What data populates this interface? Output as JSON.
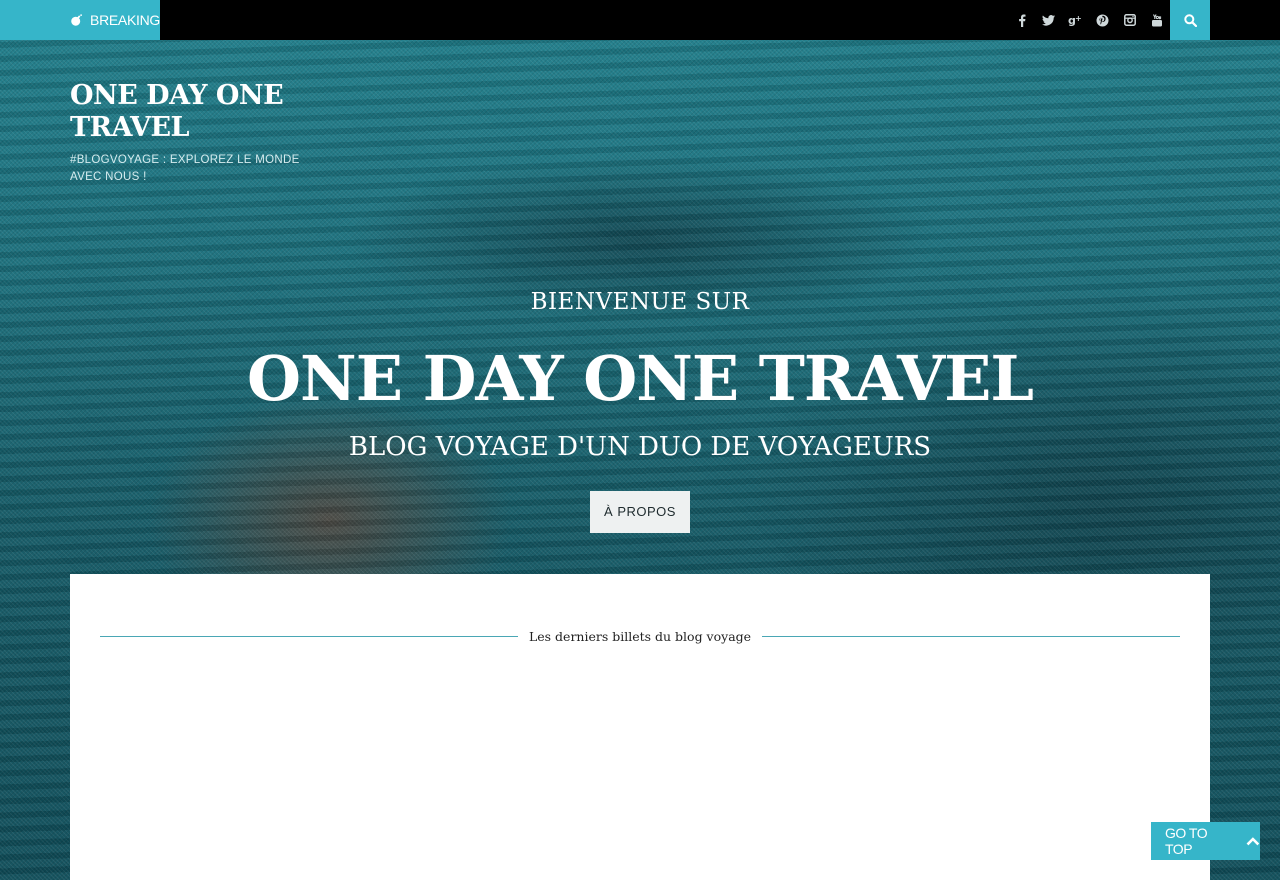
{
  "topbar": {
    "breaking_label": "BREAKING",
    "social": [
      {
        "icon": "facebook-icon",
        "glyph": "f"
      },
      {
        "icon": "twitter-icon",
        "glyph": "t"
      },
      {
        "icon": "google-plus-icon",
        "glyph": "g+"
      },
      {
        "icon": "pinterest-icon",
        "glyph": "p"
      },
      {
        "icon": "instagram-icon",
        "glyph": "◙"
      },
      {
        "icon": "youtube-icon",
        "glyph": "▶"
      }
    ],
    "search_icon": "search-icon"
  },
  "header": {
    "site_title": "ONE DAY ONE TRAVEL",
    "site_description": "#BLOGVOYAGE : EXPLOREZ LE MONDE AVEC NOUS !"
  },
  "hero": {
    "welcome": "BIENVENUE SUR",
    "title": "ONE DAY ONE TRAVEL",
    "tagline": "BLOG VOYAGE D'UN DUO DE VOYAGEURS",
    "about_button": "À PROPOS"
  },
  "content": {
    "section_title": "Les derniers billets du blog voyage"
  },
  "go_top": {
    "label": "GO TO TOP",
    "icon": "chevron-up-icon"
  },
  "colors": {
    "accent": "#36b5c9",
    "topbar_bg": "#000000",
    "section_line": "#4aa7b5"
  }
}
